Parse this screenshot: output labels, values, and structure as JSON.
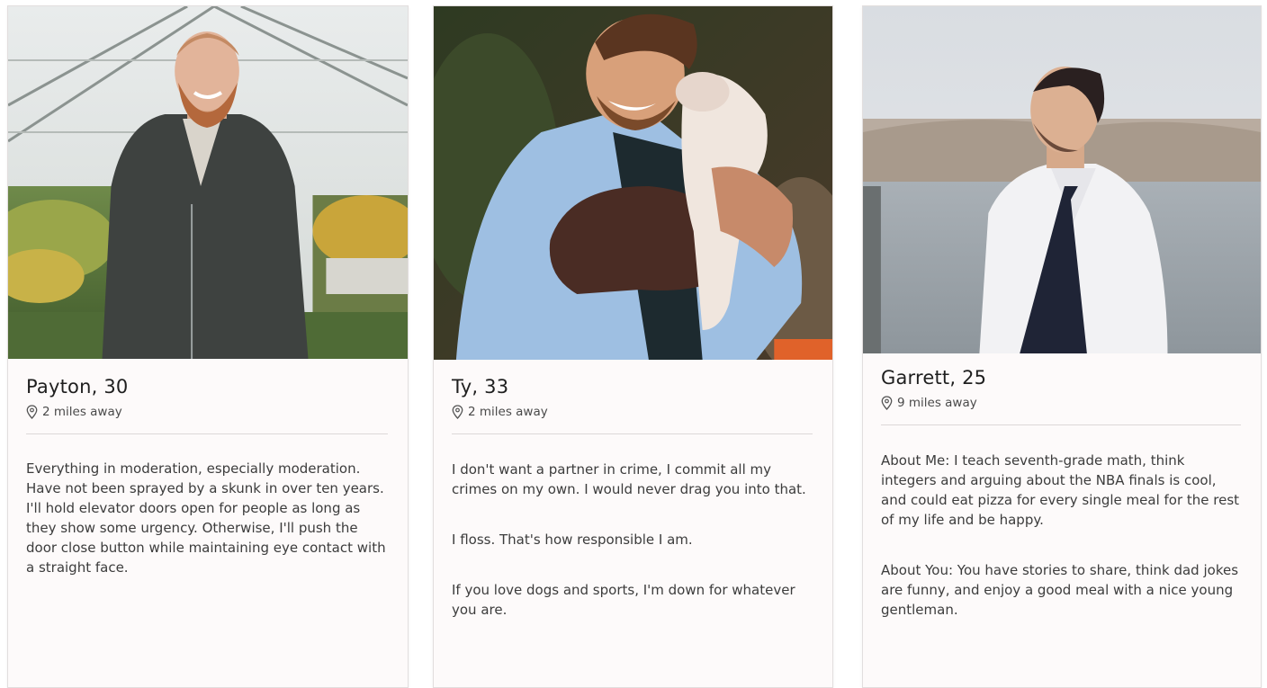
{
  "profiles": [
    {
      "name_age": "Payton, 30",
      "distance": "2 miles away",
      "photo_icon": "man-in-greenhouse-photo",
      "bio": [
        "Everything in moderation, especially moderation. Have not been sprayed by a skunk in over ten years. I'll hold elevator doors open for people as long as they show some urgency. Otherwise, I'll push the door close button while maintaining eye contact with a straight face."
      ]
    },
    {
      "name_age": "Ty, 33",
      "distance": "2 miles away",
      "photo_icon": "man-holding-dog-photo",
      "bio": [
        "I don't want a partner in crime, I commit all my crimes on my own. I would never drag you into that.",
        "I floss. That's how responsible I am.",
        "If you love dogs and sports, I'm down for whatever you are."
      ]
    },
    {
      "name_age": "Garrett, 25",
      "distance": "9 miles away",
      "photo_icon": "man-by-lake-photo",
      "bio": [
        "About Me: I teach seventh-grade math, think integers and arguing about the NBA finals is cool, and could eat pizza for every single meal for the rest of my life and be happy.",
        "About You: You have stories to share, think dad jokes are funny, and enjoy a good meal with a nice young gentleman."
      ]
    }
  ],
  "colors": {
    "card_background": "#fdfafa",
    "divider": "#dcd8d8",
    "name_text": "#1f1f1f",
    "body_text": "#3c3c3c"
  }
}
